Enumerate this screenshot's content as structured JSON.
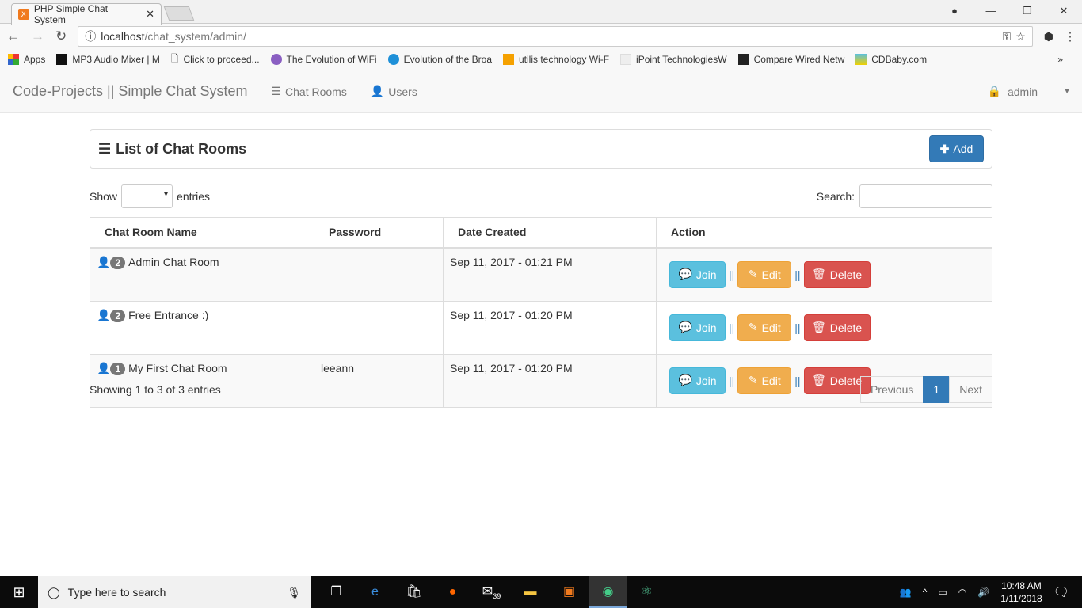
{
  "browser": {
    "tab_title": "PHP Simple Chat System",
    "url_host": "localhost",
    "url_path": "/chat_system/admin/",
    "bookmarks": [
      "Apps",
      "MP3 Audio Mixer | M",
      "Click to proceed...",
      "The Evolution of WiFi",
      "Evolution of the Broa",
      "utilis technology Wi-F",
      "iPoint TechnologiesW",
      "Compare Wired Netw",
      "CDBaby.com"
    ]
  },
  "navbar": {
    "brand": "Code-Projects || Simple Chat System",
    "links": [
      "Chat Rooms",
      "Users"
    ],
    "user": "admin"
  },
  "panel": {
    "title": "List of Chat Rooms",
    "add_label": "Add"
  },
  "controls": {
    "show": "Show",
    "entries": "entries",
    "search": "Search:"
  },
  "table": {
    "headers": [
      "Chat Room Name",
      "Password",
      "Date Created",
      "Action"
    ],
    "rows": [
      {
        "count": "2",
        "name": "Admin Chat Room",
        "password": "",
        "date": "Sep 11, 2017 - 01:21 PM"
      },
      {
        "count": "2",
        "name": "Free Entrance :)",
        "password": "",
        "date": "Sep 11, 2017 - 01:20 PM"
      },
      {
        "count": "1",
        "name": "My First Chat Room",
        "password": "leeann",
        "date": "Sep 11, 2017 - 01:20 PM"
      }
    ],
    "actions": {
      "join": "Join",
      "edit": "Edit",
      "delete": "Delete",
      "sep": "||"
    }
  },
  "footer": {
    "info": "Showing 1 to 3 of 3 entries",
    "previous": "Previous",
    "page": "1",
    "next": "Next"
  },
  "taskbar": {
    "search_placeholder": "Type here to search",
    "mail_badge": "39",
    "time": "10:48 AM",
    "date": "1/11/2018"
  }
}
